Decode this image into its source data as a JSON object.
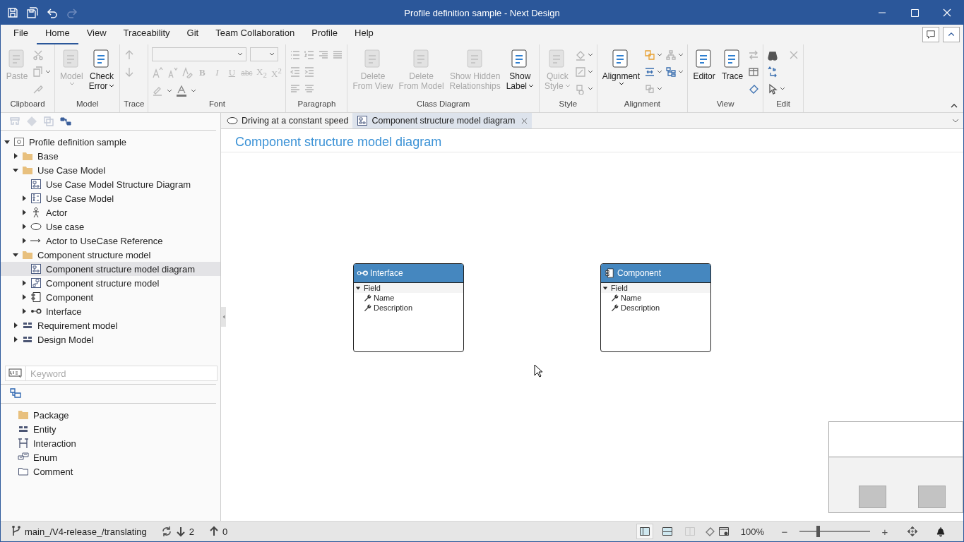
{
  "window": {
    "title": "Profile definition sample - Next Design"
  },
  "menu": [
    {
      "label": "File",
      "selected": false
    },
    {
      "label": "Home",
      "selected": true
    },
    {
      "label": "View",
      "selected": false
    },
    {
      "label": "Traceability",
      "selected": false
    },
    {
      "label": "Git",
      "selected": false
    },
    {
      "label": "Team Collaboration",
      "selected": false
    },
    {
      "label": "Profile",
      "selected": false
    },
    {
      "label": "Help",
      "selected": false
    }
  ],
  "ribbon": [
    {
      "label": "Clipboard",
      "kind": "standard",
      "buttons": [
        {
          "lines": [
            "Paste"
          ],
          "disabled": true,
          "dropdown": false
        }
      ]
    },
    {
      "label": "Model",
      "kind": "standard",
      "buttons": [
        {
          "lines": [
            "Model"
          ],
          "disabled": true,
          "dropdown": true
        },
        {
          "lines": [
            "Check",
            "Error"
          ],
          "disabled": false,
          "dropdown": true
        }
      ]
    },
    {
      "label": "Trace",
      "kind": "standard"
    },
    {
      "label": "Font",
      "kind": "font",
      "format_buttons": [
        {
          "label": "B",
          "disabled": true
        },
        {
          "label": "I",
          "disabled": true
        },
        {
          "label": "U",
          "disabled": true
        },
        {
          "label": "abc",
          "disabled": true
        },
        {
          "label": "X$_{2}$",
          "disabled": true
        },
        {
          "label": "X$^{2}$",
          "disabled": true
        }
      ]
    },
    {
      "label": "Paragraph",
      "kind": "standard"
    },
    {
      "label": "Class Diagram",
      "kind": "standard",
      "buttons": [
        {
          "lines": [
            "Delete",
            "From View"
          ],
          "disabled": true,
          "dropdown": false
        },
        {
          "lines": [
            "Delete",
            "From Model"
          ],
          "disabled": true,
          "dropdown": false
        },
        {
          "lines": [
            "Show Hidden",
            "Relationships"
          ],
          "disabled": true,
          "dropdown": false
        },
        {
          "lines": [
            "Show",
            "Label"
          ],
          "disabled": false,
          "dropdown": true
        }
      ]
    },
    {
      "label": "Style",
      "kind": "standard",
      "buttons": [
        {
          "lines": [
            "Quick",
            "Style"
          ],
          "disabled": true,
          "dropdown": true
        }
      ]
    },
    {
      "label": "Alignment",
      "kind": "standard",
      "buttons": [
        {
          "lines": [
            "Alignment"
          ],
          "disabled": false,
          "dropdown": true
        }
      ]
    },
    {
      "label": "View",
      "kind": "standard",
      "buttons": [
        {
          "lines": [
            "Editor"
          ],
          "disabled": false,
          "dropdown": false
        },
        {
          "lines": [
            "Trace"
          ],
          "disabled": false,
          "dropdown": false
        }
      ]
    },
    {
      "label": "Edit",
      "kind": "standard"
    }
  ],
  "tree": [
    {
      "label": "Profile definition sample",
      "kind": "root",
      "expandable": true,
      "expanded": true,
      "selected": false,
      "children": [
        {
          "label": "Base",
          "kind": "folder",
          "expandable": true,
          "expanded": false,
          "selected": false
        },
        {
          "label": "Use Case Model",
          "kind": "folder",
          "expandable": true,
          "expanded": true,
          "selected": false,
          "children": [
            {
              "label": "Use Case Model Structure Diagram",
              "kind": "diagram",
              "expandable": false,
              "selected": false
            },
            {
              "label": "Use Case Model",
              "kind": "usecase-model",
              "expandable": true,
              "expanded": false,
              "selected": false
            },
            {
              "label": "Actor",
              "kind": "actor",
              "expandable": true,
              "expanded": false,
              "selected": false
            },
            {
              "label": "Use case",
              "kind": "usecase",
              "expandable": true,
              "expanded": false,
              "selected": false
            },
            {
              "label": "Actor to UseCase Reference",
              "kind": "reference",
              "expandable": true,
              "expanded": false,
              "selected": false
            }
          ]
        },
        {
          "label": "Component structure model",
          "kind": "folder",
          "expandable": true,
          "expanded": true,
          "selected": false,
          "children": [
            {
              "label": "Component structure model diagram",
              "kind": "diagram",
              "expandable": false,
              "selected": true
            },
            {
              "label": "Component structure model",
              "kind": "component-model",
              "expandable": true,
              "expanded": false,
              "selected": false
            },
            {
              "label": "Component",
              "kind": "component",
              "expandable": true,
              "expanded": false,
              "selected": false
            },
            {
              "label": "Interface",
              "kind": "interface",
              "expandable": true,
              "expanded": false,
              "selected": false
            }
          ]
        },
        {
          "label": "Requirement model",
          "kind": "entity",
          "expandable": true,
          "expanded": false,
          "selected": false
        },
        {
          "label": "Design Model",
          "kind": "entity",
          "expandable": true,
          "expanded": false,
          "selected": false
        }
      ]
    }
  ],
  "search": {
    "placeholder": "Keyword"
  },
  "toolbox": [
    {
      "label": "Package",
      "kind": "folder"
    },
    {
      "label": "Entity",
      "kind": "entity"
    },
    {
      "label": "Interaction",
      "kind": "interaction"
    },
    {
      "label": "Enum",
      "kind": "enum"
    },
    {
      "label": "Comment",
      "kind": "comment"
    }
  ],
  "doc_tabs": [
    {
      "label": "Driving at a constant speed",
      "kind": "usecase",
      "selected": false
    },
    {
      "label": "Component structure model diagram",
      "kind": "diagram",
      "selected": true
    }
  ],
  "diagram": {
    "title": "Component structure model diagram",
    "boxes": [
      {
        "title": "Interface",
        "kind": "interface",
        "section": "Field",
        "fields": [
          "Name",
          "Description"
        ]
      },
      {
        "title": "Component",
        "kind": "component",
        "section": "Field",
        "fields": [
          "Name",
          "Description"
        ]
      }
    ]
  },
  "status_bar": {
    "branch": "main_/V4-release_/translating",
    "incoming": "2",
    "outgoing": "0",
    "zoom": "100%",
    "zoom_out": "−",
    "zoom_in": "+",
    "zoom_slider": {
      "level": 0.26
    }
  }
}
